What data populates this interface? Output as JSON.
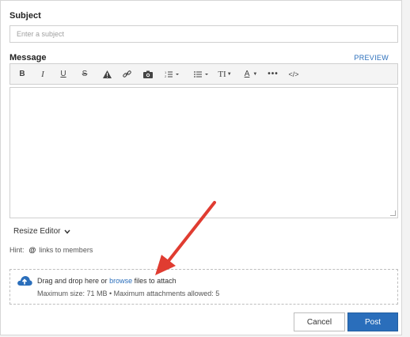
{
  "subject": {
    "label": "Subject",
    "placeholder": "Enter a subject"
  },
  "message": {
    "label": "Message",
    "preview_label": "PREVIEW"
  },
  "toolbar": {
    "bold": "B",
    "italic": "I",
    "underline": "U",
    "strike": "S",
    "text_size": "TI",
    "text_color": "A",
    "code": "</>",
    "items": [
      "bold",
      "italic",
      "underline",
      "strikethrough",
      "spoiler",
      "link",
      "image",
      "ordered-list",
      "bulleted-list",
      "text-size",
      "text-color",
      "more",
      "code"
    ]
  },
  "resize": {
    "label": "Resize Editor"
  },
  "hint": {
    "prefix": "Hint:",
    "at": "@",
    "suffix": "links to members"
  },
  "attach": {
    "text_before": "Drag and drop here or",
    "browse_link": "browse",
    "text_after": "files to attach",
    "limits": "Maximum size: 71 MB • Maximum attachments allowed: 5"
  },
  "actions": {
    "cancel": "Cancel",
    "post": "Post"
  },
  "colors": {
    "accent": "#2a6ebb",
    "arrow": "#e03c31"
  }
}
